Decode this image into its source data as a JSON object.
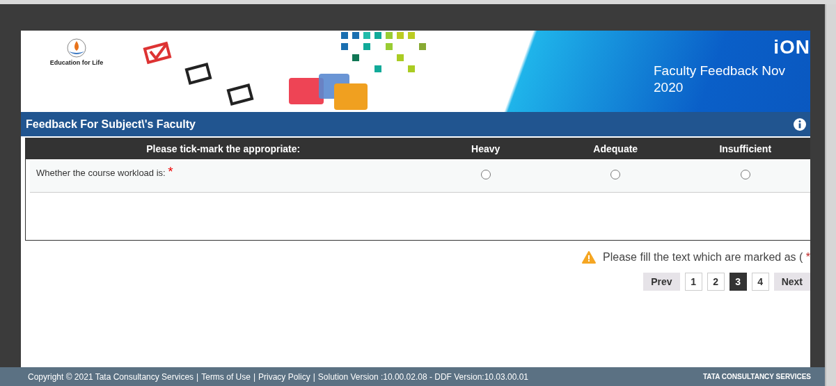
{
  "banner": {
    "logo_caption": "Education for Life",
    "brand": "iON",
    "title": "Faculty Feedback Nov 2020"
  },
  "section": {
    "title": "Feedback For Subject\\'s Faculty"
  },
  "table": {
    "columns": [
      "Please tick-mark the appropriate:",
      "Heavy",
      "Adequate",
      "Insufficient"
    ],
    "rows": [
      {
        "question": "Whether the course workload is:",
        "required_mark": "*",
        "options": [
          {
            "selected": false
          },
          {
            "selected": false
          },
          {
            "selected": false
          }
        ]
      }
    ]
  },
  "notice": {
    "text": "Please fill the text which are marked as (",
    "mark": "*"
  },
  "pagination": {
    "prev": "Prev",
    "next": "Next",
    "pages": [
      {
        "label": "1",
        "selected": false
      },
      {
        "label": "2",
        "selected": false
      },
      {
        "label": "3",
        "selected": true
      },
      {
        "label": "4",
        "selected": false
      }
    ]
  },
  "footer": {
    "copyright": "Copyright © 2021 Tata Consultancy Services",
    "separators": [
      "|",
      "|",
      "|"
    ],
    "links": [
      "Terms of Use",
      "Privacy Policy"
    ],
    "version": "Solution Version :10.00.02.08 - DDF Version:10.03.00.01",
    "brand": "TATA CONSULTANCY SERVICES"
  }
}
